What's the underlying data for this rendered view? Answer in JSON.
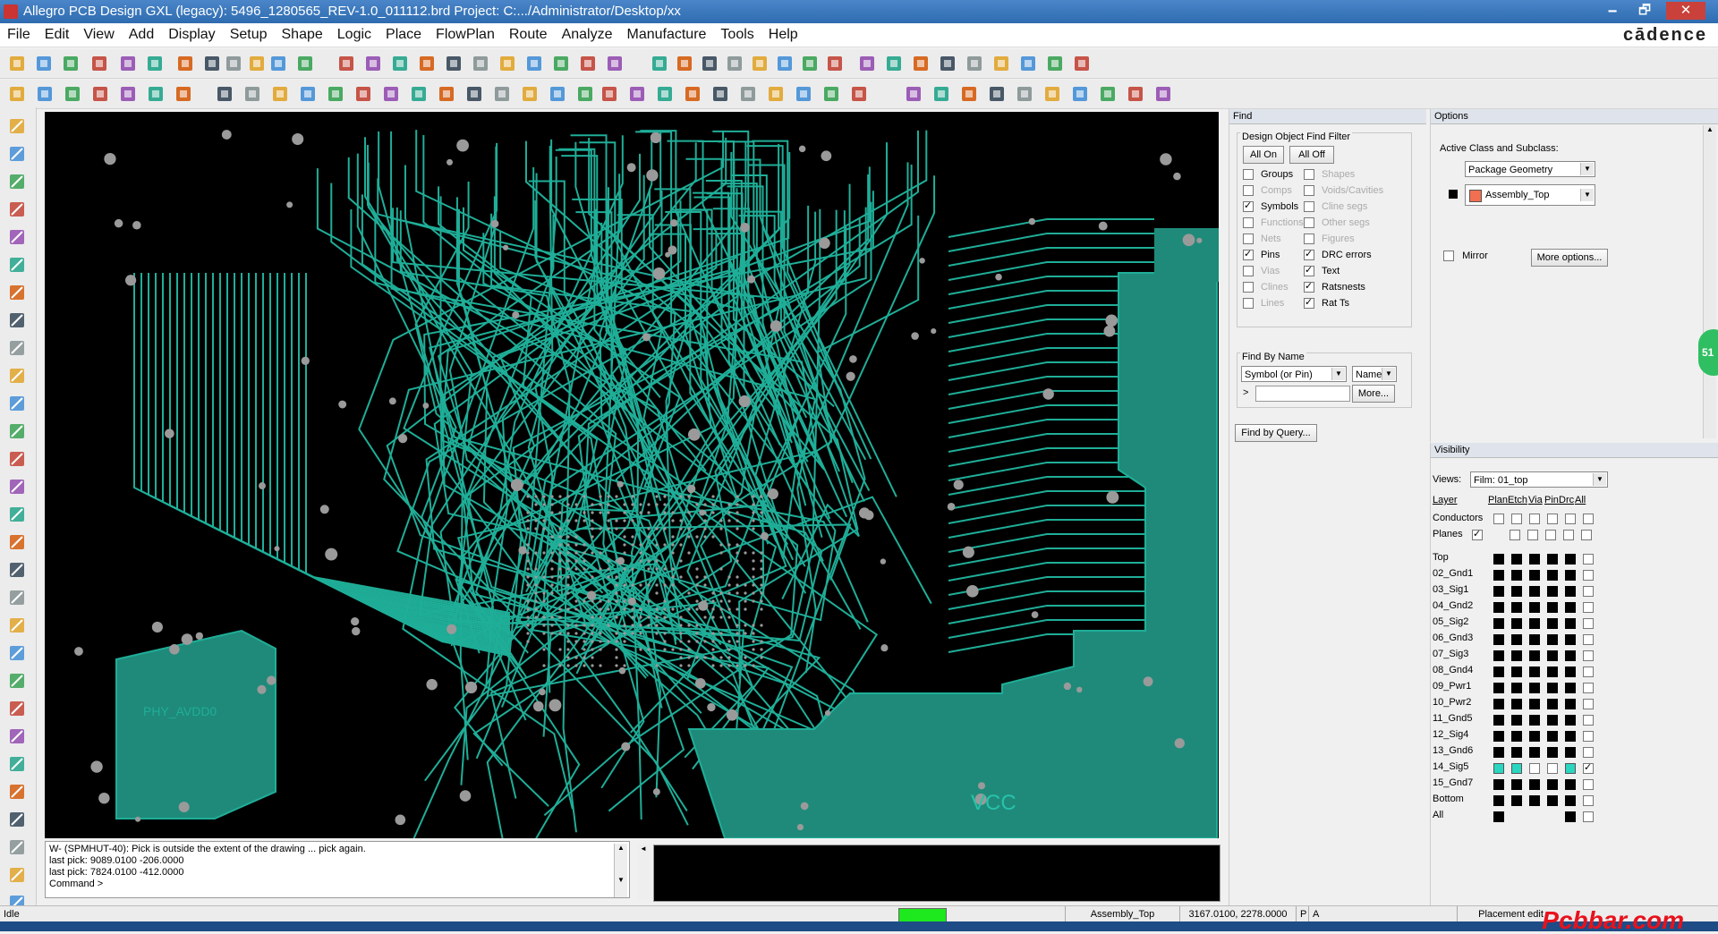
{
  "window": {
    "title": "Allegro PCB Design GXL (legacy): 5496_1280565_REV-1.0_011112.brd  Project: C:.../Administrator/Desktop/xx",
    "minimize": "🗕",
    "maximize": "🗗",
    "close": "✕"
  },
  "menubar": {
    "items": [
      "File",
      "Edit",
      "View",
      "Add",
      "Display",
      "Setup",
      "Shape",
      "Logic",
      "Place",
      "FlowPlan",
      "Route",
      "Analyze",
      "Manufacture",
      "Tools",
      "Help"
    ],
    "brand": "cādence"
  },
  "canvas": {
    "label_phy": "PHY_AVDD0",
    "label_vcc": "VCC",
    "colors": {
      "trace": "#1fae98",
      "shape": "#1f8a7a",
      "background": "#000000",
      "pad": "#9a9a9a"
    }
  },
  "command": {
    "lines": [
      "W- (SPMHUT-40): Pick is outside the extent of the drawing ... pick again.",
      "last pick:  9089.0100 -206.0000",
      "last pick:  7824.0100 -412.0000",
      "Command >"
    ]
  },
  "find": {
    "title": "Find",
    "filter_title": "Design Object Find Filter",
    "all_on": "All On",
    "all_off": "All Off",
    "items_left": [
      {
        "label": "Groups",
        "checked": false,
        "enabled": true
      },
      {
        "label": "Comps",
        "checked": false,
        "enabled": false
      },
      {
        "label": "Symbols",
        "checked": true,
        "enabled": true
      },
      {
        "label": "Functions",
        "checked": false,
        "enabled": false
      },
      {
        "label": "Nets",
        "checked": false,
        "enabled": false
      },
      {
        "label": "Pins",
        "checked": true,
        "enabled": true
      },
      {
        "label": "Vias",
        "checked": false,
        "enabled": false
      },
      {
        "label": "Clines",
        "checked": false,
        "enabled": false
      },
      {
        "label": "Lines",
        "checked": false,
        "enabled": false
      }
    ],
    "items_right": [
      {
        "label": "Shapes",
        "checked": false,
        "enabled": false
      },
      {
        "label": "Voids/Cavities",
        "checked": false,
        "enabled": false
      },
      {
        "label": "Cline segs",
        "checked": false,
        "enabled": false
      },
      {
        "label": "Other segs",
        "checked": false,
        "enabled": false
      },
      {
        "label": "Figures",
        "checked": false,
        "enabled": false
      },
      {
        "label": "DRC errors",
        "checked": true,
        "enabled": true
      },
      {
        "label": "Text",
        "checked": true,
        "enabled": true
      },
      {
        "label": "Ratsnests",
        "checked": true,
        "enabled": true
      },
      {
        "label": "Rat Ts",
        "checked": true,
        "enabled": true
      }
    ],
    "by_name_title": "Find By Name",
    "by_name_type": "Symbol (or Pin)",
    "by_name_mode": "Name",
    "prompt": ">",
    "more": "More...",
    "by_query": "Find by Query..."
  },
  "options": {
    "title": "Options",
    "active_label": "Active Class and Subclass:",
    "class": "Package Geometry",
    "subclass": "Assembly_Top",
    "subclass_color": "#f07050",
    "mirror": "Mirror",
    "more_options": "More options..."
  },
  "visibility": {
    "title": "Visibility",
    "views_label": "Views:",
    "views_value": "Film: 01_top",
    "headers": [
      "Layer",
      "Plan",
      "Etch",
      "Via",
      "Pin",
      "Drc",
      "All"
    ],
    "conductors": "Conductors",
    "planes": "Planes",
    "layers": [
      "Top",
      "02_Gnd1",
      "03_Sig1",
      "04_Gnd2",
      "05_Sig2",
      "06_Gnd3",
      "07_Sig3",
      "08_Gnd4",
      "09_Pwr1",
      "10_Pwr2",
      "11_Gnd5",
      "12_Sig4",
      "13_Gnd6",
      "14_Sig5",
      "15_Gnd7",
      "Bottom",
      "All"
    ],
    "highlight_layer": "14_Sig5"
  },
  "status": {
    "state": "Idle",
    "subclass": "Assembly_Top",
    "coords": "3167.0100, 2278.0000",
    "p": "P",
    "a": "A",
    "mode": "Placement edit",
    "watermark": "Pcbbar.com",
    "side_badge": "51"
  }
}
